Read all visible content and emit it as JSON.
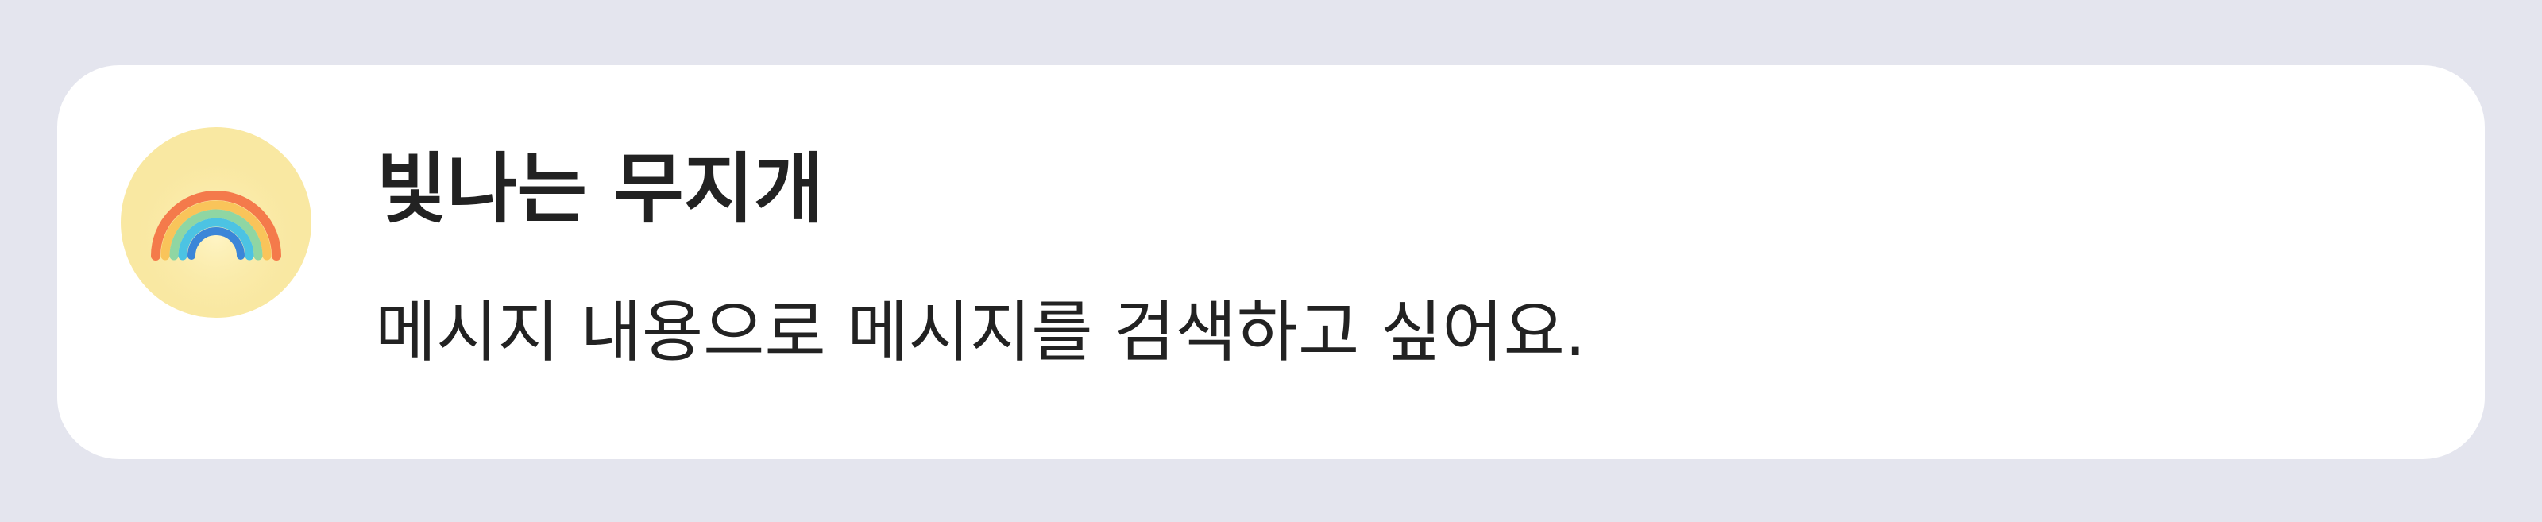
{
  "notification": {
    "avatar_icon": "rainbow-icon",
    "sender": "빛나는 무지개",
    "message": "메시지 내용으로 메시지를 검색하고 싶어요."
  },
  "colors": {
    "background": "#e4e5ee",
    "card": "#ffffff",
    "avatar_bg": "#f9e8a2",
    "text": "#222222"
  }
}
